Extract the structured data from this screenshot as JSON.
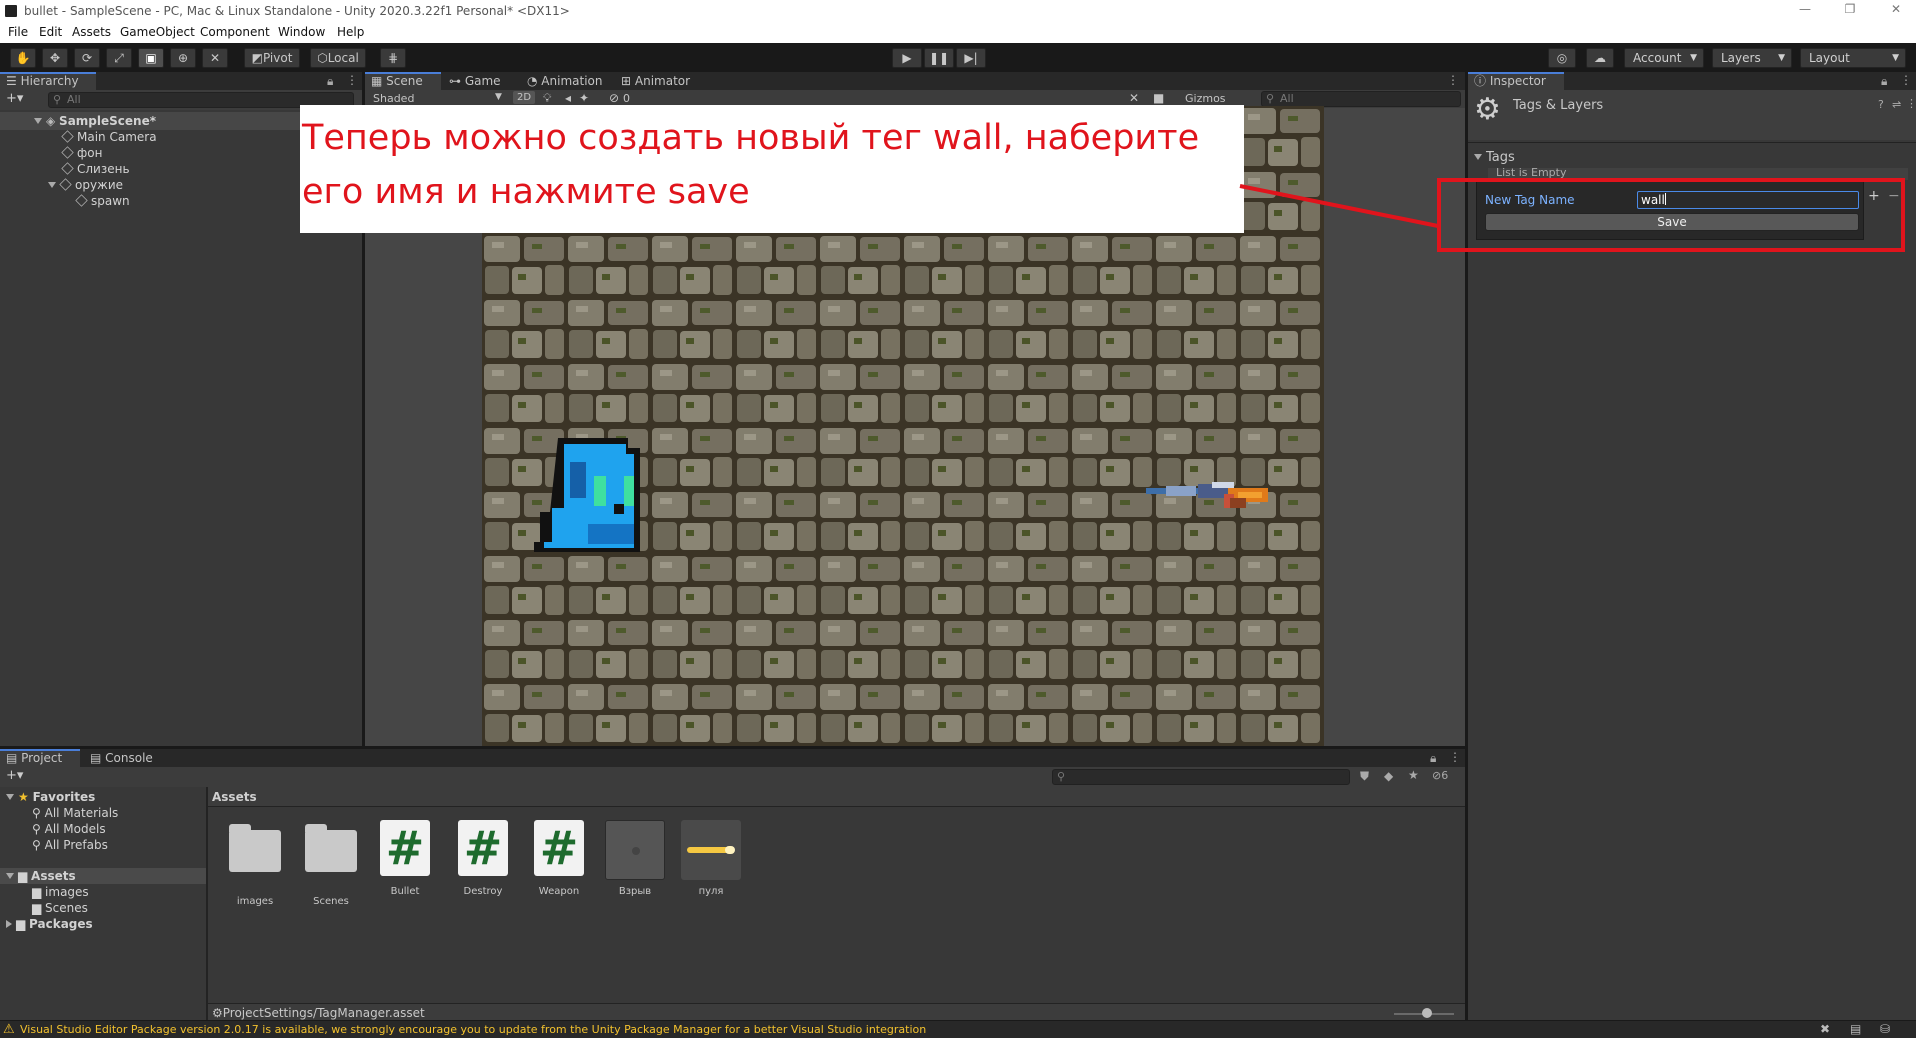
{
  "window": {
    "title": "bullet - SampleScene - PC, Mac & Linux Standalone - Unity 2020.3.22f1 Personal* <DX11>",
    "controls": {
      "minimize": "—",
      "restore": "❐",
      "close": "✕"
    }
  },
  "menu": [
    "File",
    "Edit",
    "Assets",
    "GameObject",
    "Component",
    "Window",
    "Help"
  ],
  "toolbar": {
    "pivot": "Pivot",
    "local": "Local",
    "account": "Account",
    "layers": "Layers",
    "layout": "Layout"
  },
  "hierarchy": {
    "tab": "Hierarchy",
    "search_placeholder": "All",
    "add": "+▾",
    "items": [
      "SampleScene*",
      "Main Camera",
      "фон",
      "Слизень",
      "оружие",
      "spawn"
    ]
  },
  "scene": {
    "tabs": [
      "Scene",
      "Game",
      "Animation",
      "Animator"
    ],
    "shading": "Shaded",
    "mode2d": "2D",
    "gizmos": "Gizmos",
    "search_placeholder": "All",
    "hidden_count": "0"
  },
  "annotation": {
    "line1": "Теперь можно создать новый тег wall, наберите",
    "line2": "его имя и нажмите save",
    "color": "#e0141c"
  },
  "inspector": {
    "tab": "Inspector",
    "title": "Tags & Layers",
    "tags_section": "Tags",
    "list_empty": "List is Empty",
    "new_tag_label": "New Tag Name",
    "new_tag_value": "wall",
    "save": "Save",
    "add": "+",
    "remove": "−"
  },
  "project": {
    "tabs": [
      "Project",
      "Console"
    ],
    "add": "+▾",
    "favorites": "Favorites",
    "fav_items": [
      "All Materials",
      "All Models",
      "All Prefabs"
    ],
    "assets_root": "Assets",
    "asset_folders": [
      "images",
      "Scenes"
    ],
    "packages": "Packages",
    "breadcrumb": "Assets",
    "hidden_count": "6",
    "assets": [
      {
        "name": "images",
        "kind": "folder"
      },
      {
        "name": "Scenes",
        "kind": "folder"
      },
      {
        "name": "Bullet",
        "kind": "script"
      },
      {
        "name": "Destroy",
        "kind": "script"
      },
      {
        "name": "Weapon",
        "kind": "script"
      },
      {
        "name": "Взрыв",
        "kind": "prefab"
      },
      {
        "name": "пуля",
        "kind": "sprite"
      }
    ],
    "status_path": "ProjectSettings/TagManager.asset"
  },
  "statusbar": {
    "message": "Visual Studio Editor Package version 2.0.17 is available, we strongly encourage you to update from the Unity Package Manager for a better Visual Studio integration"
  }
}
